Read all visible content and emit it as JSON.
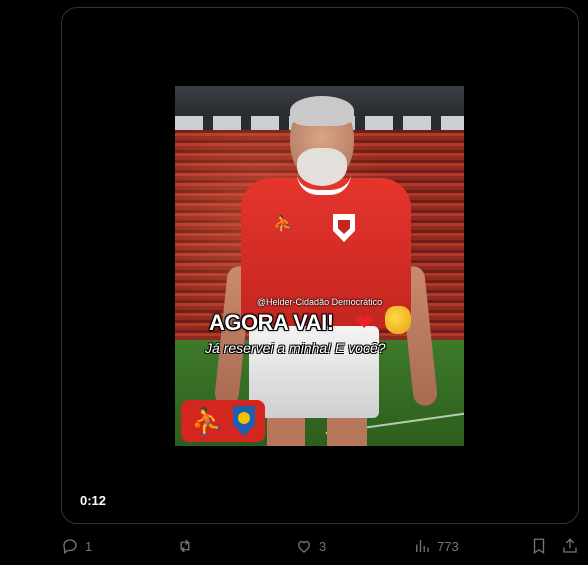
{
  "video": {
    "watermark": "@Helder-Cidadão Democrático",
    "headline": "AGORA VAI!",
    "subline": "Já reservei a minha! E você?",
    "duration": "0:12"
  },
  "actions": {
    "replies": "1",
    "reposts": "",
    "likes": "3",
    "views": "773"
  },
  "icons": [
    "reply-icon",
    "repost-icon",
    "like-icon",
    "views-icon",
    "bookmark-icon",
    "share-icon"
  ]
}
